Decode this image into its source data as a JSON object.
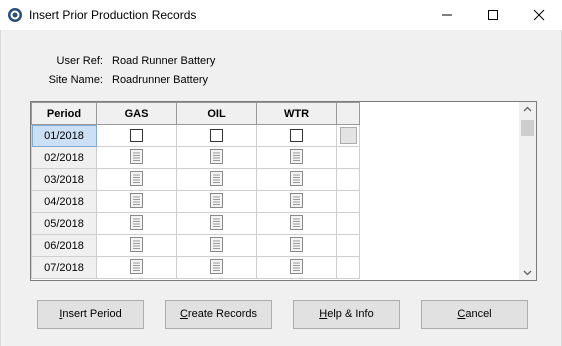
{
  "window": {
    "title": "Insert Prior Production Records"
  },
  "info": {
    "user_ref_label": "User Ref:",
    "user_ref_value": "Road Runner Battery",
    "site_name_label": "Site Name:",
    "site_name_value": "Roadrunner Battery"
  },
  "grid": {
    "columns": [
      "Period",
      "GAS",
      "OIL",
      "WTR"
    ],
    "rows": [
      {
        "period": "01/2018",
        "selected": true,
        "type": "checkbox"
      },
      {
        "period": "02/2018",
        "type": "doc"
      },
      {
        "period": "03/2018",
        "type": "doc"
      },
      {
        "period": "04/2018",
        "type": "doc"
      },
      {
        "period": "05/2018",
        "type": "doc"
      },
      {
        "period": "06/2018",
        "type": "doc"
      },
      {
        "period": "07/2018",
        "type": "doc"
      }
    ]
  },
  "buttons": {
    "insert_period": "Insert Period",
    "create_records": "Create Records",
    "help_info": "Help & Info",
    "cancel": "Cancel"
  }
}
